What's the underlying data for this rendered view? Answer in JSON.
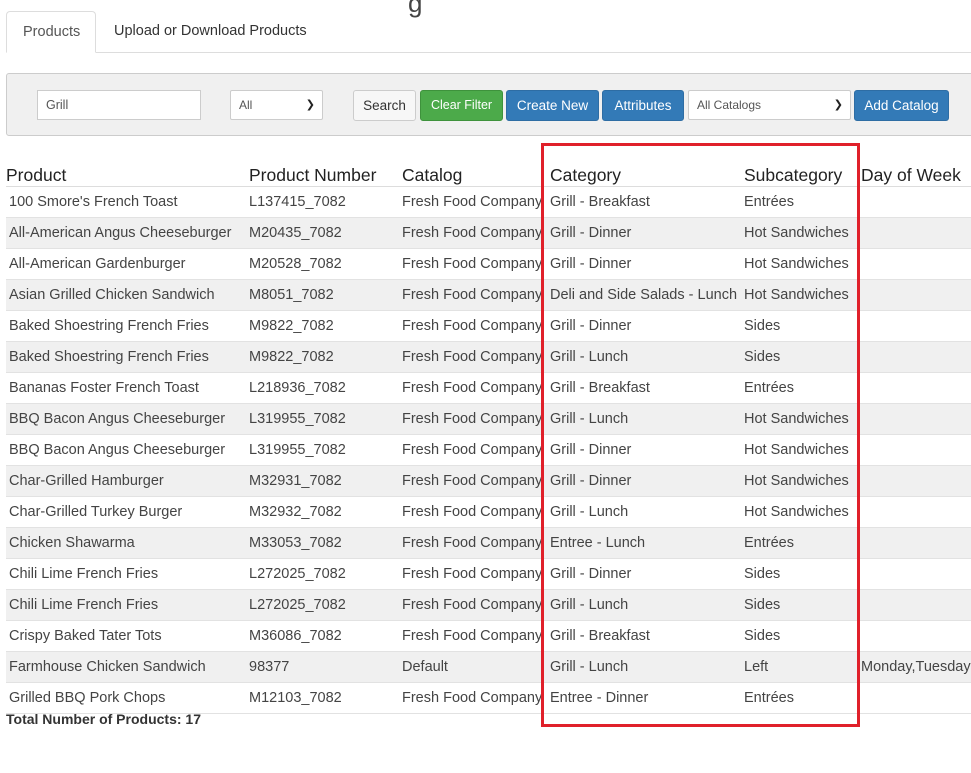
{
  "tabs": [
    {
      "label": "Products"
    },
    {
      "label": "Upload or Download Products"
    }
  ],
  "filters": {
    "search_value": "Grill",
    "type_selected": "All",
    "search_label": "Search",
    "clear_label": "Clear Filter",
    "create_label": "Create New",
    "attributes_label": "Attributes",
    "catalog_selected": "All Catalogs",
    "add_catalog_label": "Add Catalog"
  },
  "table": {
    "columns": [
      "Product",
      "Product Number",
      "Catalog",
      "Category",
      "Subcategory",
      "Day of Week"
    ],
    "rows": [
      [
        "100 Smore's French Toast",
        "L137415_7082",
        "Fresh Food Company",
        "Grill - Breakfast",
        "Entrées",
        ""
      ],
      [
        "All-American Angus Cheeseburger",
        "M20435_7082",
        "Fresh Food Company",
        "Grill - Dinner",
        "Hot Sandwiches",
        ""
      ],
      [
        "All-American Gardenburger",
        "M20528_7082",
        "Fresh Food Company",
        "Grill - Dinner",
        "Hot Sandwiches",
        ""
      ],
      [
        "Asian Grilled Chicken Sandwich",
        "M8051_7082",
        "Fresh Food Company",
        "Deli and Side Salads - Lunch",
        "Hot Sandwiches",
        ""
      ],
      [
        "Baked Shoestring French Fries",
        "M9822_7082",
        "Fresh Food Company",
        "Grill - Dinner",
        "Sides",
        ""
      ],
      [
        "Baked Shoestring French Fries",
        "M9822_7082",
        "Fresh Food Company",
        "Grill - Lunch",
        "Sides",
        ""
      ],
      [
        "Bananas Foster French Toast",
        "L218936_7082",
        "Fresh Food Company",
        "Grill - Breakfast",
        "Entrées",
        ""
      ],
      [
        "BBQ Bacon Angus Cheeseburger",
        "L319955_7082",
        "Fresh Food Company",
        "Grill - Lunch",
        "Hot Sandwiches",
        ""
      ],
      [
        "BBQ Bacon Angus Cheeseburger",
        "L319955_7082",
        "Fresh Food Company",
        "Grill - Dinner",
        "Hot Sandwiches",
        ""
      ],
      [
        "Char-Grilled Hamburger",
        "M32931_7082",
        "Fresh Food Company",
        "Grill - Dinner",
        "Hot Sandwiches",
        ""
      ],
      [
        "Char-Grilled Turkey Burger",
        "M32932_7082",
        "Fresh Food Company",
        "Grill - Lunch",
        "Hot Sandwiches",
        ""
      ],
      [
        "Chicken Shawarma",
        "M33053_7082",
        "Fresh Food Company",
        "Entree - Lunch",
        "Entrées",
        ""
      ],
      [
        "Chili Lime French Fries",
        "L272025_7082",
        "Fresh Food Company",
        "Grill - Dinner",
        "Sides",
        ""
      ],
      [
        "Chili Lime French Fries",
        "L272025_7082",
        "Fresh Food Company",
        "Grill - Lunch",
        "Sides",
        ""
      ],
      [
        "Crispy Baked Tater Tots",
        "M36086_7082",
        "Fresh Food Company",
        "Grill - Breakfast",
        "Sides",
        ""
      ],
      [
        "Farmhouse Chicken Sandwich",
        "98377",
        "Default",
        "Grill - Lunch",
        "Left",
        "Monday,Tuesday"
      ],
      [
        "Grilled BBQ Pork Chops",
        "M12103_7082",
        "Fresh Food Company",
        "Entree - Dinner",
        "Entrées",
        ""
      ]
    ]
  },
  "total_label": "Total Number of Products: 17",
  "highlight_color": "#e0202a"
}
